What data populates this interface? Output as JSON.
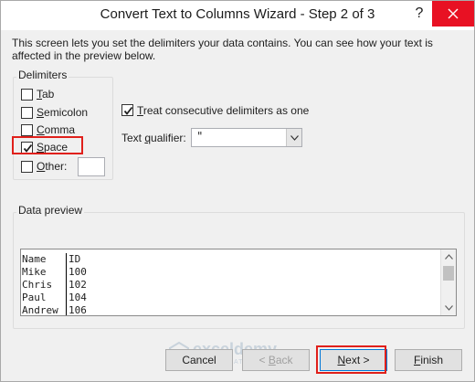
{
  "window": {
    "title": "Convert Text to Columns Wizard - Step 2 of 3",
    "help_glyph": "?"
  },
  "intro": "This screen lets you set the delimiters your data contains.  You can see how your text is affected in the preview below.",
  "delimiters": {
    "legend": "Delimiters",
    "items": [
      {
        "mnemonic": "T",
        "rest": "ab",
        "checked": false
      },
      {
        "mnemonic": "S",
        "rest": "emicolon",
        "checked": false
      },
      {
        "mnemonic": "C",
        "rest": "omma",
        "checked": false
      },
      {
        "mnemonic": "S",
        "rest": "pace",
        "checked": true
      },
      {
        "mnemonic": "O",
        "rest": "ther:",
        "checked": false
      }
    ],
    "other_value": ""
  },
  "options": {
    "consecutive_pre": "",
    "consecutive_mnemonic": "T",
    "consecutive_rest": "reat consecutive delimiters as one",
    "consecutive_checked": true,
    "qualifier_pre": "Text ",
    "qualifier_mnemonic": "q",
    "qualifier_rest": "ualifier:",
    "qualifier_value": "\""
  },
  "preview": {
    "legend": "Data preview",
    "rows": [
      [
        "Name",
        "ID"
      ],
      [
        "Mike",
        "100"
      ],
      [
        "Chris",
        "102"
      ],
      [
        "Paul",
        "104"
      ],
      [
        "Andrew",
        "106"
      ]
    ]
  },
  "buttons": {
    "cancel": "Cancel",
    "back_pre": "< ",
    "back_mnemonic": "B",
    "back_rest": "ack",
    "next_mnemonic": "N",
    "next_rest": "ext >",
    "finish_mnemonic": "F",
    "finish_rest": "inish"
  },
  "watermark": {
    "name": "exceldemy",
    "tag": "EXCEL · DATA · BI"
  },
  "colors": {
    "close_button": "#e81123",
    "highlight": "#e0201b",
    "primary_border": "#0078d7"
  }
}
